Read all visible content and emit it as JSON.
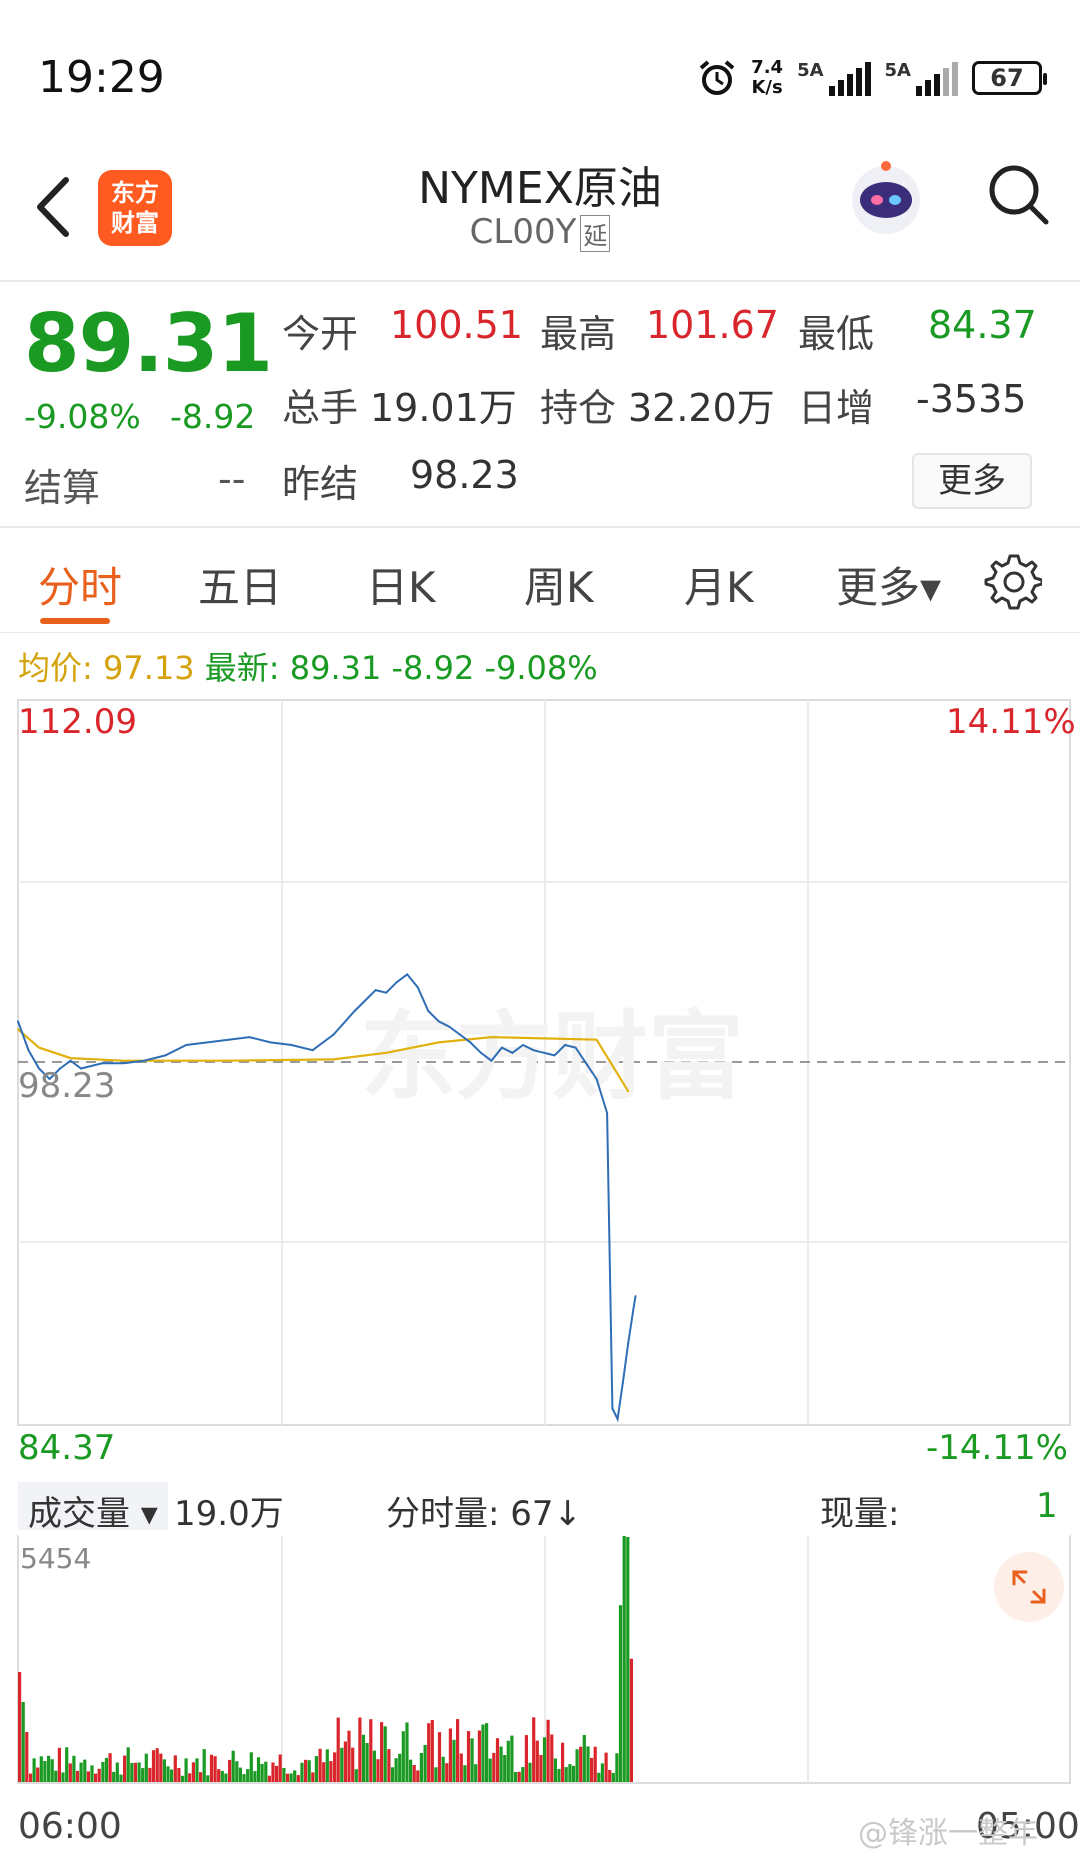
{
  "status_bar": {
    "time": "19:29",
    "net_speed_value": "7.4",
    "net_speed_unit": "K/s",
    "signal1_label": "5A",
    "signal2_label": "5A",
    "battery": "67"
  },
  "header": {
    "logo_line1": "东方",
    "logo_line2": "财富",
    "title": "NYMEX原油",
    "subtitle": "CL00Y",
    "subtitle_tag": "延"
  },
  "quote": {
    "last_price": "89.31",
    "change_pct": "-9.08%",
    "change": "-8.92",
    "open_label": "今开",
    "open": "100.51",
    "high_label": "最高",
    "high": "101.67",
    "low_label": "最低",
    "low": "84.37",
    "volume_label": "总手",
    "volume": "19.01万",
    "oi_label": "持仓",
    "oi": "32.20万",
    "daily_inc_label": "日增",
    "daily_inc": "-3535",
    "settle_label": "结算",
    "settle": "--",
    "prev_settle_label": "昨结",
    "prev_settle": "98.23",
    "more_button": "更多"
  },
  "tabs": [
    {
      "label": "分时",
      "active": true
    },
    {
      "label": "五日"
    },
    {
      "label": "日K"
    },
    {
      "label": "周K"
    },
    {
      "label": "月K"
    },
    {
      "label": "更多▾"
    }
  ],
  "info_line": {
    "avg_label": "均价:",
    "avg_value": "97.13",
    "latest_label": "最新:",
    "latest_value": "89.31 -8.92 -9.08%"
  },
  "chart": {
    "y_max_label": "112.09",
    "y_min_label": "84.37",
    "pct_max_label": "14.11%",
    "pct_min_label": "-14.11%",
    "ref_label": "98.23",
    "vol_max_label": "5454",
    "x_start": "06:00",
    "x_end": "05:00",
    "volume_selector": "成交量 ▾",
    "volume_total": "19.0万",
    "tick_volume": "分时量:  67↓",
    "current_volume_label": "现量:",
    "current_volume_value": "1",
    "watermark": "东方财富",
    "credit": "@锋涨一整年",
    "colors": {
      "price_line": "#2f6db5",
      "avg_line": "#e0b10f",
      "up": "#d9262c",
      "down": "#1a9a23"
    }
  },
  "chart_data": {
    "type": "line",
    "x_range": [
      "06:00",
      "05:00"
    ],
    "ylim": [
      84.37,
      112.09
    ],
    "reference": 98.23,
    "series": [
      {
        "name": "最新",
        "x_fraction": [
          0.0,
          0.01,
          0.02,
          0.03,
          0.04,
          0.05,
          0.06,
          0.08,
          0.1,
          0.12,
          0.14,
          0.16,
          0.18,
          0.2,
          0.22,
          0.24,
          0.26,
          0.28,
          0.3,
          0.32,
          0.33,
          0.34,
          0.35,
          0.36,
          0.37,
          0.38,
          0.39,
          0.4,
          0.41,
          0.42,
          0.43,
          0.44,
          0.45,
          0.46,
          0.47,
          0.48,
          0.49,
          0.5,
          0.51,
          0.52,
          0.53,
          0.54,
          0.55,
          0.56,
          0.565,
          0.57,
          0.575,
          0.58,
          0.585,
          0.587
        ],
        "values": [
          99.8,
          98.7,
          98.0,
          97.6,
          98.0,
          98.3,
          98.0,
          98.2,
          98.2,
          98.3,
          98.5,
          98.9,
          99.0,
          99.1,
          99.2,
          99.0,
          98.9,
          98.7,
          99.3,
          100.2,
          100.6,
          101.0,
          100.9,
          101.3,
          101.6,
          101.1,
          100.2,
          99.8,
          99.6,
          99.3,
          99.0,
          98.6,
          98.3,
          98.8,
          98.6,
          98.9,
          98.7,
          98.6,
          98.5,
          98.9,
          98.8,
          98.2,
          97.6,
          96.3,
          85.0,
          84.6,
          86.0,
          87.5,
          88.8,
          89.3
        ]
      },
      {
        "name": "均价",
        "x_fraction": [
          0.0,
          0.02,
          0.05,
          0.1,
          0.2,
          0.3,
          0.35,
          0.4,
          0.45,
          0.5,
          0.55,
          0.58
        ],
        "values": [
          99.5,
          98.8,
          98.4,
          98.3,
          98.3,
          98.35,
          98.6,
          99.0,
          99.2,
          99.15,
          99.1,
          97.13
        ]
      }
    ]
  }
}
